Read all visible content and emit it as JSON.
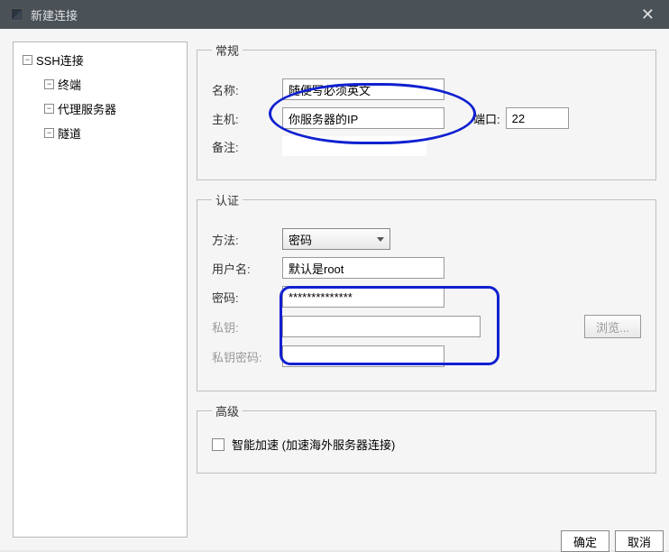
{
  "titlebar": {
    "title": "新建连接"
  },
  "sidebar": {
    "root": "SSH连接",
    "children": [
      "终端",
      "代理服务器",
      "隧道"
    ]
  },
  "sections": {
    "general": {
      "legend": "常规",
      "name_label": "名称:",
      "name_value": "随便写必须英文",
      "host_label": "主机:",
      "host_value": "你服务器的IP",
      "port_label": "端口:",
      "port_value": "22",
      "remark_label": "备注:"
    },
    "auth": {
      "legend": "认证",
      "method_label": "方法:",
      "method_value": "密码",
      "user_label": "用户名:",
      "user_value": "默认是root",
      "pass_label": "密码:",
      "pass_value": "**************",
      "privatekey_label": "私钥:",
      "browse_btn": "浏览...",
      "keypass_label": "私钥密码:"
    },
    "advanced": {
      "legend": "高级",
      "checkbox_label": "智能加速 (加速海外服务器连接)"
    }
  },
  "buttons": {
    "ok": "确定",
    "cancel": "取消"
  }
}
